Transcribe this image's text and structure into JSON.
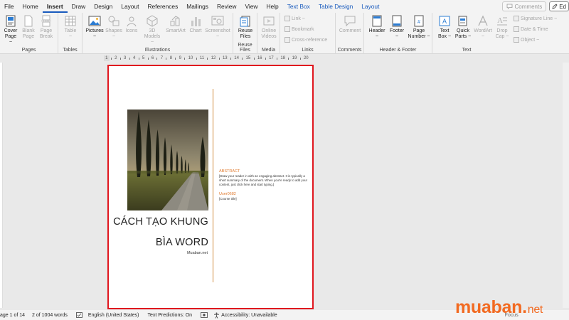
{
  "menu": {
    "tabs": [
      "File",
      "Home",
      "Insert",
      "Draw",
      "Design",
      "Layout",
      "References",
      "Mailings",
      "Review",
      "View",
      "Help"
    ],
    "active": "Insert",
    "context_tabs": [
      "Text Box",
      "Table Design",
      "Layout"
    ],
    "comments_label": "Comments",
    "edit_label": "Ed"
  },
  "ribbon": {
    "groups": {
      "pages": "Pages",
      "tables": "Tables",
      "illustrations": "Illustrations",
      "reuse": "Reuse Files",
      "media": "Media",
      "links": "Links",
      "comments": "Comments",
      "header_footer": "Header & Footer",
      "text": "Text"
    },
    "buttons": {
      "cover_page": [
        "Cover",
        "Page ~"
      ],
      "blank_page": [
        "Blank",
        "Page"
      ],
      "page_break": [
        "Page",
        "Break"
      ],
      "table": [
        "Table",
        "~"
      ],
      "pictures": [
        "Pictures",
        "~"
      ],
      "shapes": [
        "Shapes",
        "~"
      ],
      "icons": [
        "Icons",
        ""
      ],
      "models_3d": [
        "3D",
        "Models ~"
      ],
      "smartart": [
        "SmartArt",
        ""
      ],
      "chart": [
        "Chart",
        ""
      ],
      "screenshot": [
        "Screenshot",
        "~"
      ],
      "reuse_files": [
        "Reuse",
        "Files"
      ],
      "online_videos": [
        "Online",
        "Videos"
      ],
      "comment": [
        "Comment",
        ""
      ],
      "header": [
        "Header",
        "~"
      ],
      "footer": [
        "Footer",
        "~"
      ],
      "page_number": [
        "Page",
        "Number ~"
      ],
      "text_box": [
        "Text",
        "Box ~"
      ],
      "quick_parts": [
        "Quick",
        "Parts ~"
      ],
      "wordart": [
        "WordArt",
        "~"
      ],
      "drop_cap": [
        "Drop",
        "Cap ~"
      ]
    },
    "links": [
      "Link ~",
      "Bookmark",
      "Cross-reference"
    ],
    "text_small": [
      "Signature Line ~",
      "Date & Time",
      "Object ~"
    ]
  },
  "ruler": {
    "labels": [
      "1",
      "2",
      "3",
      "4",
      "5",
      "6",
      "7",
      "8",
      "9",
      "10",
      "11",
      "12",
      "13",
      "14",
      "15",
      "16",
      "17",
      "18",
      "19",
      "20"
    ]
  },
  "document": {
    "title_lines": [
      "CÁCH TẠO KHUNG",
      "BÌA WORD"
    ],
    "site": "Muaban.net",
    "abstract_heading": "ABSTRACT",
    "abstract_text": "[Draw your reader in with an engaging abstract. It is typically a short summary of the document. When you're ready to add your content, just click here and start typing.]",
    "user": "User0682",
    "course": "[Course title]"
  },
  "status": {
    "page": "age 1 of 14",
    "words": "2 of 1004 words",
    "language": "English (United States)",
    "predictions": "Text Predictions: On",
    "accessibility": "Accessibility: Unavailable",
    "focus": "Focus"
  },
  "watermark": {
    "brand": "muaban",
    "tld": "net"
  },
  "colors": {
    "accent": "#185abd",
    "highlight_border": "#e0161e",
    "abstract_orange": "#e07a2e",
    "brand_orange": "#f26a21"
  }
}
